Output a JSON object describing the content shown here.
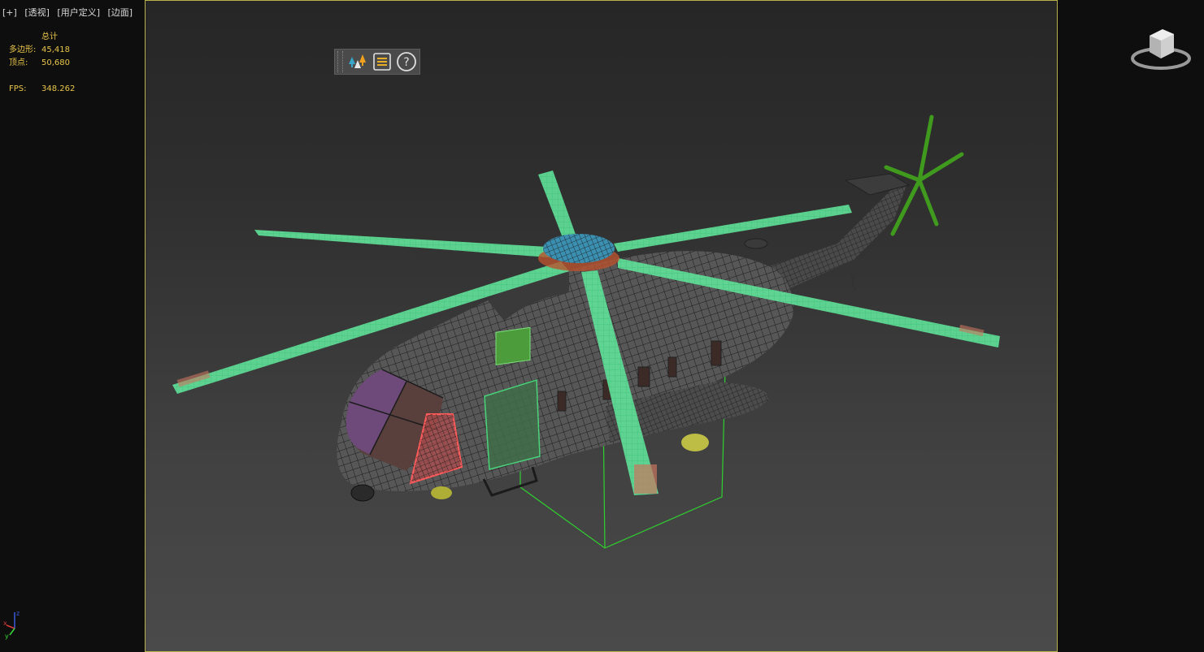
{
  "viewport": {
    "labels": [
      "[+]",
      "[透视]",
      "[用户定义]",
      "[边面]"
    ]
  },
  "stats": {
    "header": "总计",
    "polygons_label": "多边形:",
    "polygons_value": "45,418",
    "vertices_label": "顶点:",
    "vertices_value": "50,680",
    "fps_label": "FPS:",
    "fps_value": "348.262"
  },
  "toolbar": {
    "icons": [
      "scene-trees-icon",
      "list-icon",
      "help-icon"
    ]
  },
  "axis": {
    "x": "x",
    "y": "y",
    "z": "z"
  },
  "colors": {
    "frame": "#b7b34a",
    "stats": "#e8c64a",
    "rotor": "#62e39a",
    "tail_rotor": "#3f9a1e",
    "bbox": "#2fd12f",
    "hub": "#3b8fb0",
    "mesh": "#1b1b1b",
    "body": "#535353"
  }
}
